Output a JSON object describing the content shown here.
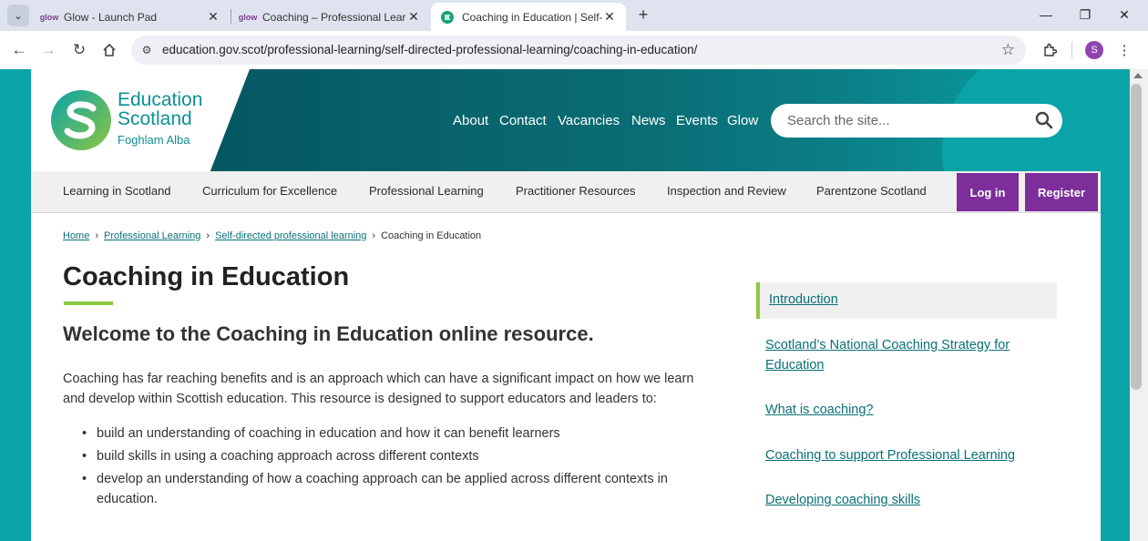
{
  "browser": {
    "tabs": [
      {
        "title": "Glow - Launch Pad",
        "favicon": "glow-favicon",
        "active": false
      },
      {
        "title": "Coaching – Professional Learnin",
        "favicon": "glow-favicon",
        "active": false
      },
      {
        "title": "Coaching in Education | Self-dir",
        "favicon": "education-scotland-favicon",
        "active": true
      }
    ],
    "favicon_text": "glow",
    "url": "education.gov.scot/professional-learning/self-directed-professional-learning/coaching-in-education/",
    "profile_initial": "S"
  },
  "site": {
    "logo": {
      "line1": "Education",
      "line2": "Scotland",
      "line3": "Foghlam Alba"
    },
    "top_links": [
      "About",
      "Contact",
      "Vacancies",
      "News",
      "Events",
      "Glow"
    ],
    "search_placeholder": "Search the site...",
    "main_nav": [
      "Learning in Scotland",
      "Curriculum for Excellence",
      "Professional Learning",
      "Practitioner Resources",
      "Inspection and Review",
      "Parentzone Scotland"
    ],
    "login_label": "Log in",
    "register_label": "Register",
    "colors": {
      "brand_teal": "#0aa3a8",
      "dark_teal": "#034f5b",
      "accent_green": "#8dc63f",
      "purple": "#7d2e9b",
      "link": "#0a7077"
    }
  },
  "breadcrumb": [
    "Home",
    "Professional Learning",
    "Self-directed professional learning",
    "Coaching in Education"
  ],
  "content": {
    "title": "Coaching in Education",
    "subtitle": "Welcome to the Coaching in Education online resource.",
    "intro": "Coaching has far reaching benefits and is an approach which can have a significant impact on how we learn and develop within Scottish education. This resource is designed to support educators and leaders to:",
    "bullets": [
      "build an understanding of coaching in education and how it can benefit learners",
      "build skills in using a coaching approach across different contexts",
      "develop an understanding of how a coaching approach can be applied across different contexts in education."
    ]
  },
  "side_nav": [
    "Introduction",
    "Scotland’s National Coaching Strategy for Education",
    "What is coaching?",
    "Coaching to support Professional Learning",
    "Developing coaching skills"
  ]
}
